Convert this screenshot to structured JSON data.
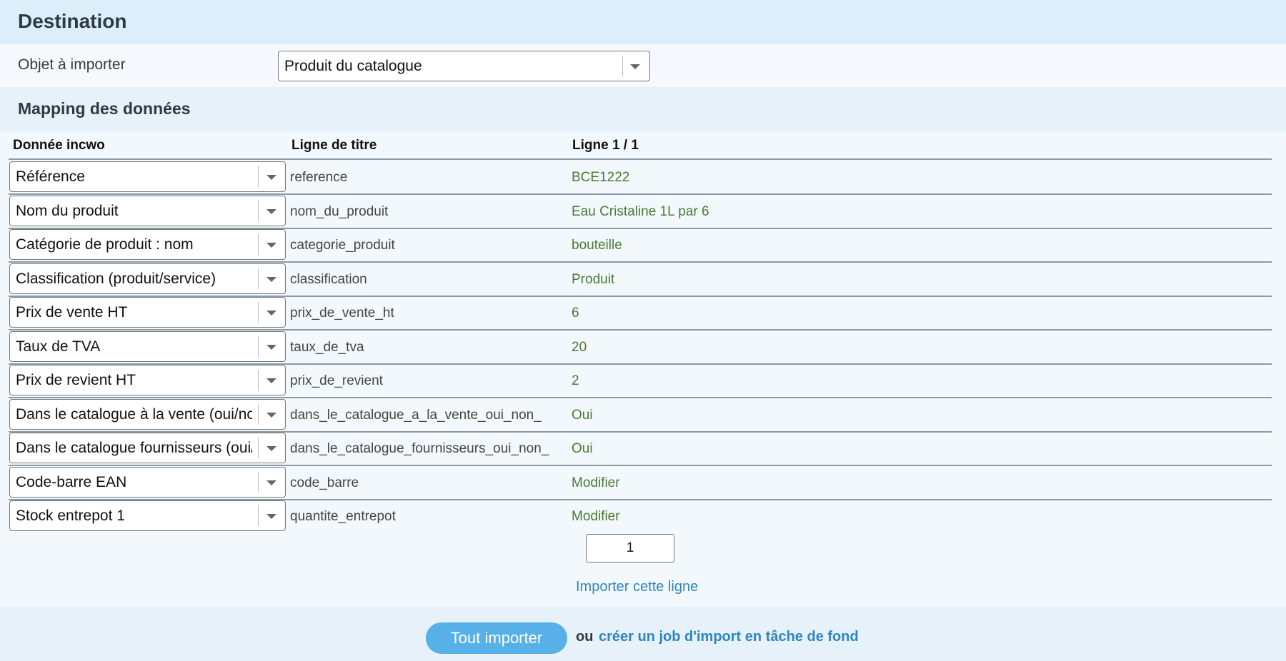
{
  "destination": {
    "title": "Destination",
    "object_label": "Objet à importer",
    "object_value": "Produit du catalogue"
  },
  "mapping": {
    "title": "Mapping des données",
    "columns": [
      "Donnée incwo",
      "Ligne de titre",
      "Ligne 1 / 1"
    ],
    "rows": [
      {
        "field": "Référence",
        "title": "reference",
        "value": "BCE1222"
      },
      {
        "field": "Nom du produit",
        "title": "nom_du_produit",
        "value": "Eau Cristaline 1L par 6"
      },
      {
        "field": "Catégorie de produit : nom",
        "title": "categorie_produit",
        "value": "bouteille"
      },
      {
        "field": "Classification (produit/service)",
        "title": "classification",
        "value": "Produit"
      },
      {
        "field": "Prix de vente HT",
        "title": "prix_de_vente_ht",
        "value": "6"
      },
      {
        "field": "Taux de TVA",
        "title": "taux_de_tva",
        "value": "20"
      },
      {
        "field": "Prix de revient HT",
        "title": "prix_de_revient",
        "value": "2"
      },
      {
        "field": "Dans le catalogue à la vente (oui/no",
        "title": "dans_le_catalogue_a_la_vente_oui_non_",
        "value": "Oui"
      },
      {
        "field": "Dans le catalogue fournisseurs (oui/",
        "title": "dans_le_catalogue_fournisseurs_oui_non_",
        "value": "Oui"
      },
      {
        "field": "Code-barre EAN",
        "title": "code_barre",
        "value": "Modifier"
      },
      {
        "field": "Stock entrepot 1",
        "title": "quantite_entrepot",
        "value": "Modifier"
      }
    ]
  },
  "line_input": {
    "value": "1"
  },
  "import_line_label": "Importer cette ligne",
  "footer": {
    "import_all_label": "Tout importer",
    "or_label": "ou",
    "background_job_label": "créer un job d'import en tâche de fond"
  },
  "colors": {
    "header_bg": "#ddeefa",
    "value_green": "#4a7a32",
    "link_blue": "#2d86c2",
    "button_blue": "#58b0e8"
  }
}
